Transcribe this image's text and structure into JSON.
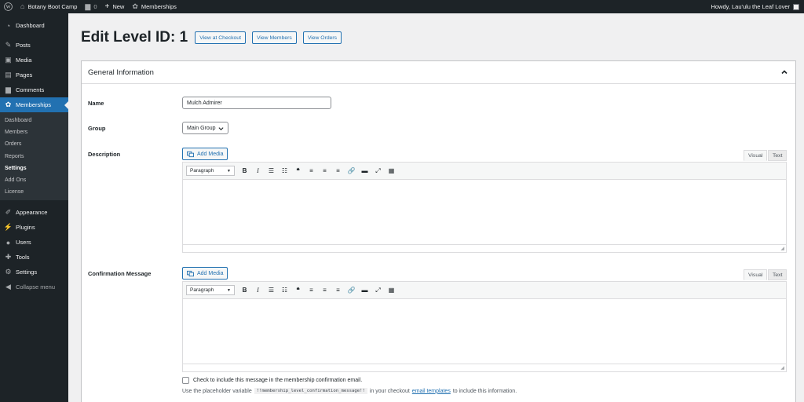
{
  "admin_bar": {
    "site_name": "Botany Boot Camp",
    "comments_count": "0",
    "new_label": "New",
    "memberships_label": "Memberships",
    "howdy": "Howdy, Lau'ulu the Leaf Lover"
  },
  "sidebar": {
    "items_top": [
      {
        "label": "Dashboard",
        "icon": "dashboard-icon"
      },
      {
        "label": "Posts",
        "icon": "pushpin-icon"
      },
      {
        "label": "Media",
        "icon": "media-icon"
      },
      {
        "label": "Pages",
        "icon": "pages-icon"
      },
      {
        "label": "Comments",
        "icon": "comment-icon"
      },
      {
        "label": "Memberships",
        "icon": "memberships-icon"
      }
    ],
    "submenu": [
      "Dashboard",
      "Members",
      "Orders",
      "Reports",
      "Settings",
      "Add Ons",
      "License"
    ],
    "items_bottom": [
      {
        "label": "Appearance",
        "icon": "brush-icon"
      },
      {
        "label": "Plugins",
        "icon": "plugin-icon"
      },
      {
        "label": "Users",
        "icon": "users-icon"
      },
      {
        "label": "Tools",
        "icon": "wrench-icon"
      },
      {
        "label": "Settings",
        "icon": "settings-icon"
      }
    ],
    "collapse_label": "Collapse menu"
  },
  "header": {
    "title": "Edit Level ID: 1",
    "buttons": [
      "View at Checkout",
      "View Members",
      "View Orders"
    ]
  },
  "panel": {
    "title": "General Information",
    "name_label": "Name",
    "name_value": "Mulch Admirer",
    "group_label": "Group",
    "group_value": "Main Group",
    "description_label": "Description",
    "confirmation_label": "Confirmation Message",
    "add_media": "Add Media",
    "tab_visual": "Visual",
    "tab_text": "Text",
    "paragraph": "Paragraph",
    "checkbox_label": "Check to include this message in the membership confirmation email.",
    "hint_before": "Use the placeholder variable",
    "hint_code": "!!membership_level_confirmation_message!!",
    "hint_middle": "in your checkout",
    "hint_link": "email templates",
    "hint_after": "to include this information."
  },
  "colors": {
    "admin_bar": "#1d2327",
    "sidebar": "#1d2327",
    "accent": "#2271b1",
    "background": "#f0f0f1"
  }
}
